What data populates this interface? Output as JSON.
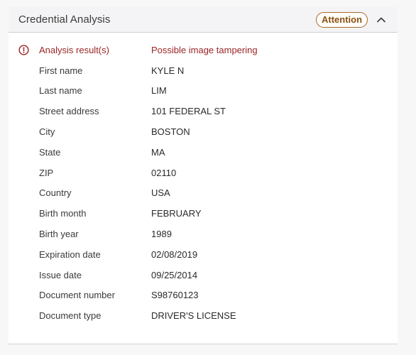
{
  "panel": {
    "title": "Credential Analysis",
    "badge": "Attention",
    "accent_color": "#8a4f10",
    "alert_color": "#9b2525"
  },
  "rows": [
    {
      "label": "Analysis result(s)",
      "value": "Possible image tampering",
      "alert": true
    },
    {
      "label": "First name",
      "value": "KYLE N"
    },
    {
      "label": "Last name",
      "value": "LIM"
    },
    {
      "label": "Street address",
      "value": "101 FEDERAL ST"
    },
    {
      "label": "City",
      "value": "BOSTON"
    },
    {
      "label": "State",
      "value": "MA"
    },
    {
      "label": "ZIP",
      "value": "02110"
    },
    {
      "label": "Country",
      "value": "USA"
    },
    {
      "label": "Birth month",
      "value": "FEBRUARY"
    },
    {
      "label": "Birth year",
      "value": "1989"
    },
    {
      "label": "Expiration date",
      "value": "02/08/2019"
    },
    {
      "label": "Issue date",
      "value": "09/25/2014"
    },
    {
      "label": "Document number",
      "value": "S98760123"
    },
    {
      "label": "Document type",
      "value": "DRIVER'S LICENSE"
    }
  ],
  "icons": {
    "collapse": "chevron-up-icon",
    "alert": "alert-circle-icon"
  }
}
